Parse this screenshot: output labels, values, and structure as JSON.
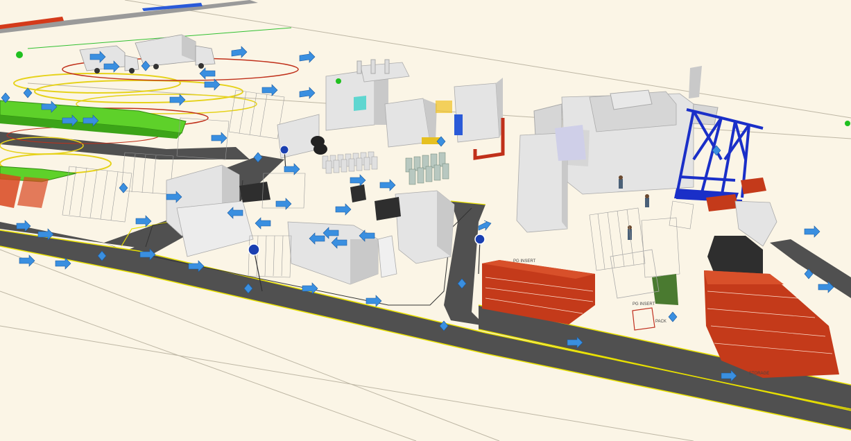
{
  "scene": {
    "labels": {
      "area_a": "PG INSERT",
      "area_b": "PG INSERT",
      "area_c": "PACK",
      "area_d": "STORAGE"
    }
  },
  "colors": {
    "background": "#fbf5e6",
    "road": "#505050",
    "road_edge": "#e8e000",
    "building": "#e4e4e4",
    "building_shade": "#c9c9c9",
    "crane": "#1a2fc8",
    "pallet": "#c43a1a",
    "conveyor_green": "#5ed12a",
    "rail_yellow": "#e6d21a",
    "rail_red": "#c0301a",
    "marker_blue": "#3a8fe0",
    "marker_green": "#20c020",
    "sign_blue": "#1a3fb0",
    "dark_machine": "#2e2e2e"
  }
}
